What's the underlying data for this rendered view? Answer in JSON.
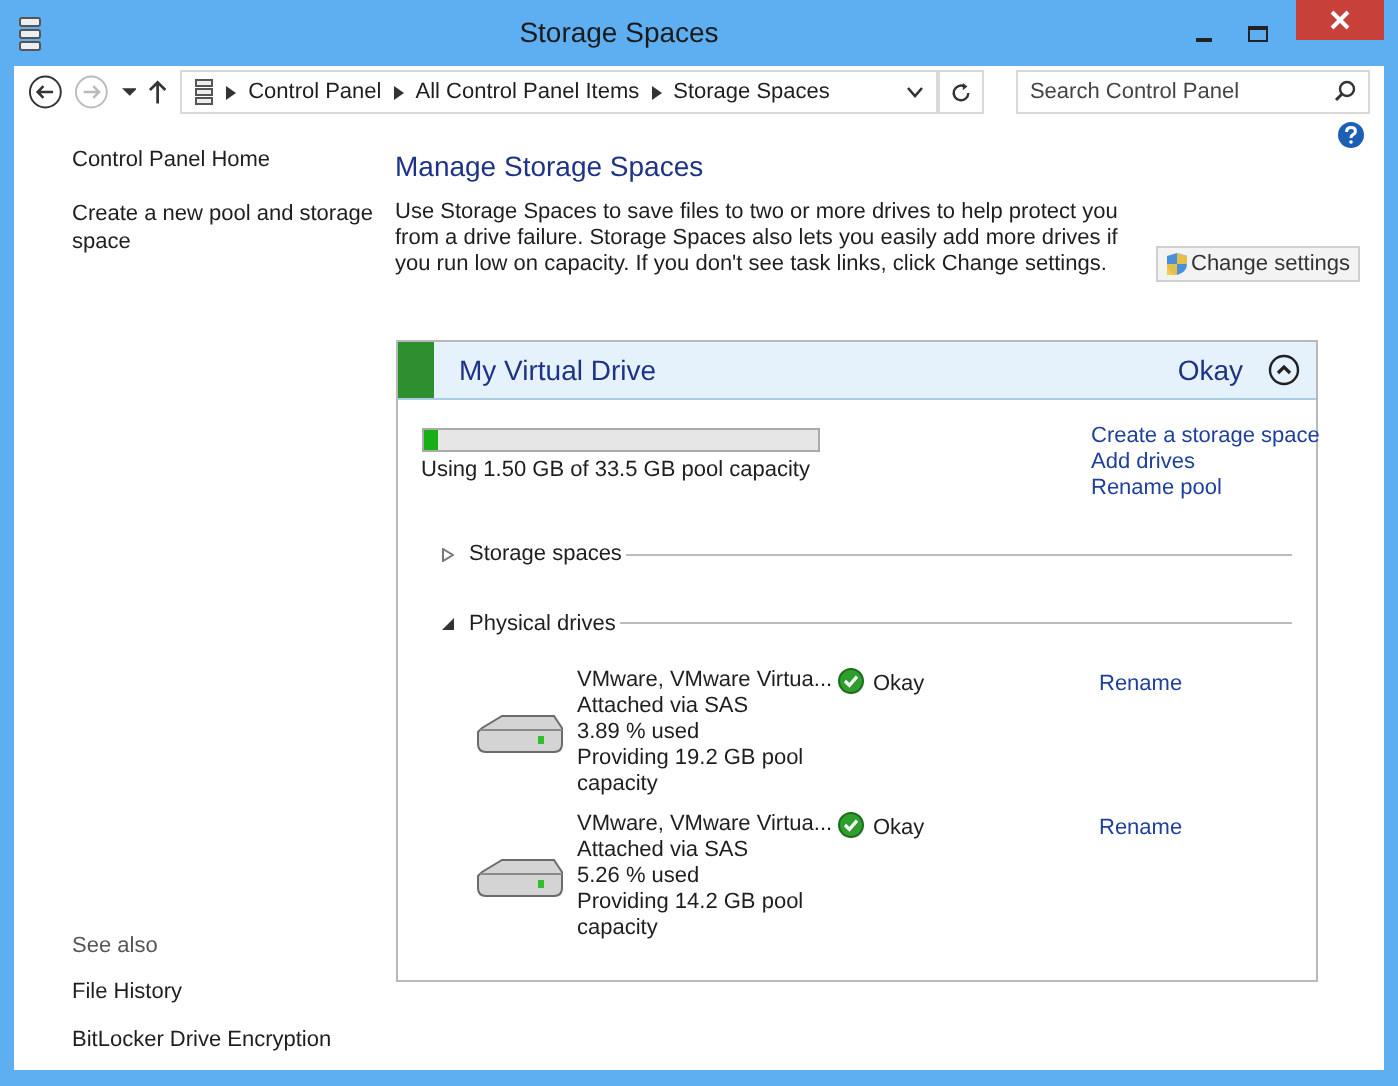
{
  "window": {
    "title": "Storage Spaces"
  },
  "address_bar": {
    "breadcrumb": [
      "Control Panel",
      "All Control Panel Items",
      "Storage Spaces"
    ]
  },
  "search": {
    "placeholder": "Search Control Panel"
  },
  "sidebar": {
    "items": [
      "Control Panel Home",
      "Create a new pool and storage space"
    ],
    "see_also": {
      "title": "See also",
      "items": [
        "File History",
        "BitLocker Drive Encryption"
      ]
    }
  },
  "main": {
    "heading": "Manage Storage Spaces",
    "description": "Use Storage Spaces to save files to two or more drives to help protect you from a drive failure. Storage Spaces also lets you easily add more drives if you run low on capacity. If you don't see task links, click Change settings.",
    "change_settings": "Change settings"
  },
  "pool": {
    "name": "My Virtual Drive",
    "status": "Okay",
    "expanded": true,
    "usage": {
      "level": 0.04,
      "text": "Using 1.50 GB of 33.5 GB pool capacity"
    },
    "tasks": [
      "Create a storage space",
      "Add drives",
      "Rename pool"
    ],
    "sections": [
      {
        "label": "Storage spaces",
        "expanded": false
      },
      {
        "label": "Physical drives",
        "expanded": true
      }
    ],
    "drives": [
      {
        "name": "VMware, VMware Virtua...",
        "lines": [
          "Attached via SAS",
          "3.89 % used",
          "Providing 19.2 GB pool capacity"
        ],
        "status": "Okay",
        "action": "Rename"
      },
      {
        "name": "VMware, VMware Virtua...",
        "lines": [
          "Attached via SAS",
          "5.26 % used",
          "Providing 14.2 GB pool capacity"
        ],
        "status": "Okay",
        "action": "Rename"
      }
    ]
  }
}
